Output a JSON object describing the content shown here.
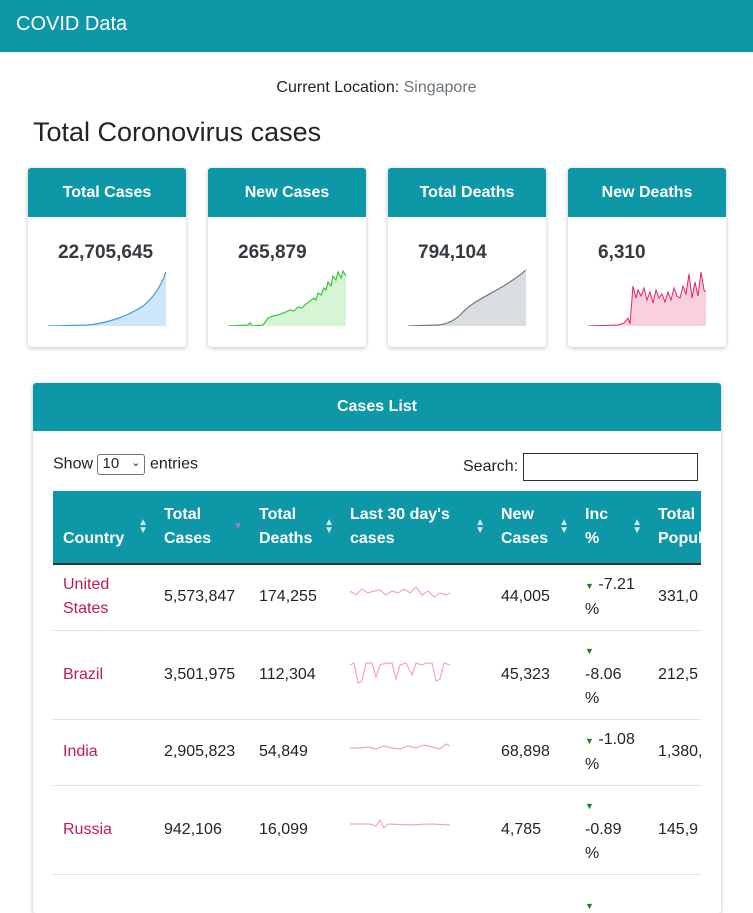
{
  "app": {
    "title": "COVID Data"
  },
  "location": {
    "label": "Current Location:",
    "value": "Singapore"
  },
  "page_title": "Total Coronovirus cases",
  "cards": [
    {
      "title": "Total Cases",
      "value": "22,705,645",
      "color": "#3fa0e0",
      "fill": "#cde6fa"
    },
    {
      "title": "New Cases",
      "value": "265,879",
      "color": "#3cc43c",
      "fill": "#d5f5d5"
    },
    {
      "title": "Total Deaths",
      "value": "794,104",
      "color": "#6b7a82",
      "fill": "#d7dde0"
    },
    {
      "title": "New Deaths",
      "value": "6,310",
      "color": "#e0245e",
      "fill": "#fad0dc"
    }
  ],
  "panel": {
    "title": "Cases List",
    "show_label": "Show",
    "entries_value": "10",
    "entries_label": "entries",
    "search_label": "Search:"
  },
  "table": {
    "headers": {
      "country": "Country",
      "total_cases_1": "Total",
      "total_cases_2": "Cases",
      "total_deaths_1": "Total",
      "total_deaths_2": "Deaths",
      "last30_1": "Last 30 day's",
      "last30_2": "cases",
      "new_cases_1": "New",
      "new_cases_2": "Cases",
      "inc_1": "Inc",
      "inc_2": "%",
      "pop_1": "Total",
      "pop_2": "Population"
    },
    "rows": [
      {
        "country_1": "United",
        "country_2": "States",
        "total_cases": "5,573,847",
        "total_deaths": "174,255",
        "new_cases": "44,005",
        "inc": "-7.21",
        "inc_unit": "%",
        "pop": "331,0"
      },
      {
        "country_1": "Brazil",
        "country_2": "",
        "total_cases": "3,501,975",
        "total_deaths": "112,304",
        "new_cases": "45,323",
        "inc": "-8.06",
        "inc_unit": "%",
        "pop": "212,5"
      },
      {
        "country_1": "India",
        "country_2": "",
        "total_cases": "2,905,823",
        "total_deaths": "54,849",
        "new_cases": "68,898",
        "inc": "-1.08",
        "inc_unit": "%",
        "pop": "1,380,"
      },
      {
        "country_1": "Russia",
        "country_2": "",
        "total_cases": "942,106",
        "total_deaths": "16,099",
        "new_cases": "4,785",
        "inc": "-0.89",
        "inc_unit": "%",
        "pop": "145,9"
      }
    ]
  }
}
